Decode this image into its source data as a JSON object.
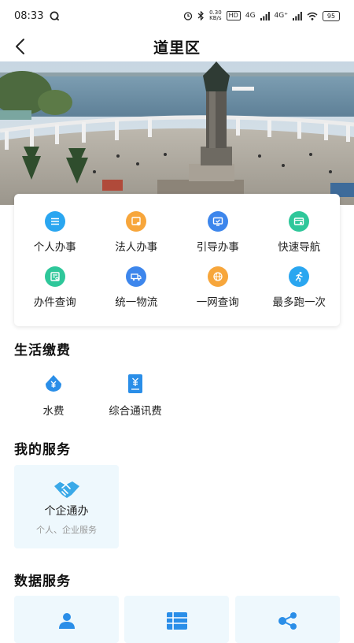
{
  "status_bar": {
    "time": "08:33",
    "net_speed_value": "0.30",
    "net_speed_unit": "KB/s",
    "hd_badge": "HD",
    "signal_1": "4G",
    "signal_2": "4G⁺",
    "battery": "95"
  },
  "header": {
    "title": "道里区"
  },
  "quick_services": [
    {
      "label": "个人办事",
      "icon": "list-icon",
      "color": "#2aa6f0"
    },
    {
      "label": "法人办事",
      "icon": "certificate-icon",
      "color": "#f7a63b"
    },
    {
      "label": "引导办事",
      "icon": "monitor-icon",
      "color": "#3d86ec"
    },
    {
      "label": "快速导航",
      "icon": "map-card-icon",
      "color": "#2ec79a"
    },
    {
      "label": "办件查询",
      "icon": "document-search-icon",
      "color": "#2ec79a"
    },
    {
      "label": "统一物流",
      "icon": "truck-icon",
      "color": "#3d86ec"
    },
    {
      "label": "一网查询",
      "icon": "globe-icon",
      "color": "#f7a63b"
    },
    {
      "label": "最多跑一次",
      "icon": "runner-icon",
      "color": "#2aa6f0"
    }
  ],
  "life_payment": {
    "title": "生活缴费",
    "items": [
      {
        "label": "水费",
        "icon": "water-drop-yen-icon"
      },
      {
        "label": "综合通讯费",
        "icon": "phone-bill-yen-icon"
      }
    ]
  },
  "my_services": {
    "title": "我的服务",
    "card": {
      "title": "个企通办",
      "subtitle": "个人、企业服务",
      "icon": "handshake-icon"
    }
  },
  "data_services": {
    "title": "数据服务",
    "cards": [
      {
        "icon": "person-icon"
      },
      {
        "icon": "table-list-icon"
      },
      {
        "icon": "share-nodes-icon"
      }
    ]
  },
  "colors": {
    "accent_blue": "#2aa6f0",
    "card_bg": "#eef8fd"
  }
}
